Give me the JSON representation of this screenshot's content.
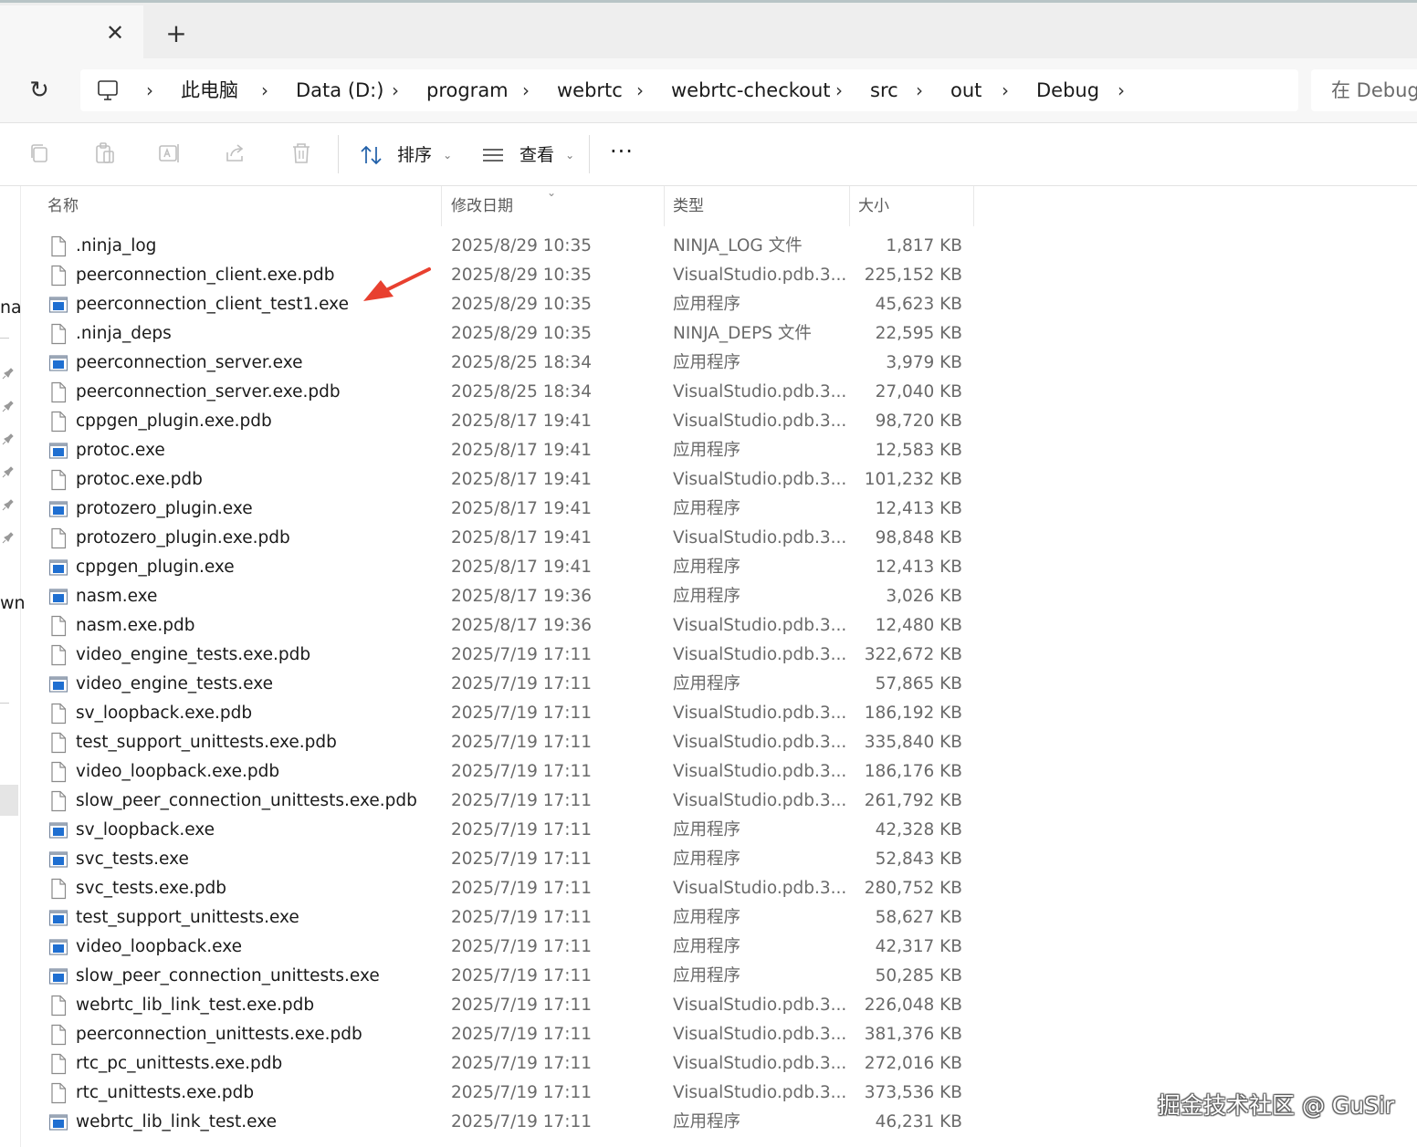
{
  "tabs": {
    "close_glyph": "✕",
    "new_glyph": "+"
  },
  "address": {
    "refresh_glyph": "↻",
    "crumbs": [
      "此电脑",
      "Data (D:)",
      "program",
      "webrtc",
      "webrtc-checkout",
      "src",
      "out",
      "Debug"
    ],
    "chevron": "›",
    "search_placeholder": "在 Debug"
  },
  "toolbar": {
    "sort_label": "排序",
    "view_label": "查看",
    "caret": "⌄",
    "more_label": "···",
    "icons": [
      "copy-icon",
      "paste-icon",
      "rename-icon",
      "share-icon",
      "delete-icon",
      "sort-icon",
      "view-icon"
    ]
  },
  "leftnav": {
    "text_1": "na",
    "text_2": "wn"
  },
  "columns": {
    "name": "名称",
    "date": "修改日期",
    "type": "类型",
    "size": "大小",
    "sort_indicator": "⌄"
  },
  "files": [
    {
      "name": ".ninja_log",
      "date": "2025/8/29 10:35",
      "type": "NINJA_LOG 文件",
      "size": "1,817 KB",
      "icon": "file"
    },
    {
      "name": "peerconnection_client.exe.pdb",
      "date": "2025/8/29 10:35",
      "type": "VisualStudio.pdb.3...",
      "size": "225,152 KB",
      "icon": "file"
    },
    {
      "name": "peerconnection_client_test1.exe",
      "date": "2025/8/29 10:35",
      "type": "应用程序",
      "size": "45,623 KB",
      "icon": "exe"
    },
    {
      "name": ".ninja_deps",
      "date": "2025/8/29 10:35",
      "type": "NINJA_DEPS 文件",
      "size": "22,595 KB",
      "icon": "file"
    },
    {
      "name": "peerconnection_server.exe",
      "date": "2025/8/25 18:34",
      "type": "应用程序",
      "size": "3,979 KB",
      "icon": "exe"
    },
    {
      "name": "peerconnection_server.exe.pdb",
      "date": "2025/8/25 18:34",
      "type": "VisualStudio.pdb.3...",
      "size": "27,040 KB",
      "icon": "file"
    },
    {
      "name": "cppgen_plugin.exe.pdb",
      "date": "2025/8/17 19:41",
      "type": "VisualStudio.pdb.3...",
      "size": "98,720 KB",
      "icon": "file"
    },
    {
      "name": "protoc.exe",
      "date": "2025/8/17 19:41",
      "type": "应用程序",
      "size": "12,583 KB",
      "icon": "exe"
    },
    {
      "name": "protoc.exe.pdb",
      "date": "2025/8/17 19:41",
      "type": "VisualStudio.pdb.3...",
      "size": "101,232 KB",
      "icon": "file"
    },
    {
      "name": "protozero_plugin.exe",
      "date": "2025/8/17 19:41",
      "type": "应用程序",
      "size": "12,413 KB",
      "icon": "exe"
    },
    {
      "name": "protozero_plugin.exe.pdb",
      "date": "2025/8/17 19:41",
      "type": "VisualStudio.pdb.3...",
      "size": "98,848 KB",
      "icon": "file"
    },
    {
      "name": "cppgen_plugin.exe",
      "date": "2025/8/17 19:41",
      "type": "应用程序",
      "size": "12,413 KB",
      "icon": "exe"
    },
    {
      "name": "nasm.exe",
      "date": "2025/8/17 19:36",
      "type": "应用程序",
      "size": "3,026 KB",
      "icon": "exe"
    },
    {
      "name": "nasm.exe.pdb",
      "date": "2025/8/17 19:36",
      "type": "VisualStudio.pdb.3...",
      "size": "12,480 KB",
      "icon": "file"
    },
    {
      "name": "video_engine_tests.exe.pdb",
      "date": "2025/7/19 17:11",
      "type": "VisualStudio.pdb.3...",
      "size": "322,672 KB",
      "icon": "file"
    },
    {
      "name": "video_engine_tests.exe",
      "date": "2025/7/19 17:11",
      "type": "应用程序",
      "size": "57,865 KB",
      "icon": "exe"
    },
    {
      "name": "sv_loopback.exe.pdb",
      "date": "2025/7/19 17:11",
      "type": "VisualStudio.pdb.3...",
      "size": "186,192 KB",
      "icon": "file"
    },
    {
      "name": "test_support_unittests.exe.pdb",
      "date": "2025/7/19 17:11",
      "type": "VisualStudio.pdb.3...",
      "size": "335,840 KB",
      "icon": "file"
    },
    {
      "name": "video_loopback.exe.pdb",
      "date": "2025/7/19 17:11",
      "type": "VisualStudio.pdb.3...",
      "size": "186,176 KB",
      "icon": "file"
    },
    {
      "name": "slow_peer_connection_unittests.exe.pdb",
      "date": "2025/7/19 17:11",
      "type": "VisualStudio.pdb.3...",
      "size": "261,792 KB",
      "icon": "file"
    },
    {
      "name": "sv_loopback.exe",
      "date": "2025/7/19 17:11",
      "type": "应用程序",
      "size": "42,328 KB",
      "icon": "exe"
    },
    {
      "name": "svc_tests.exe",
      "date": "2025/7/19 17:11",
      "type": "应用程序",
      "size": "52,843 KB",
      "icon": "exe"
    },
    {
      "name": "svc_tests.exe.pdb",
      "date": "2025/7/19 17:11",
      "type": "VisualStudio.pdb.3...",
      "size": "280,752 KB",
      "icon": "file"
    },
    {
      "name": "test_support_unittests.exe",
      "date": "2025/7/19 17:11",
      "type": "应用程序",
      "size": "58,627 KB",
      "icon": "exe"
    },
    {
      "name": "video_loopback.exe",
      "date": "2025/7/19 17:11",
      "type": "应用程序",
      "size": "42,317 KB",
      "icon": "exe"
    },
    {
      "name": "slow_peer_connection_unittests.exe",
      "date": "2025/7/19 17:11",
      "type": "应用程序",
      "size": "50,285 KB",
      "icon": "exe"
    },
    {
      "name": "webrtc_lib_link_test.exe.pdb",
      "date": "2025/7/19 17:11",
      "type": "VisualStudio.pdb.3...",
      "size": "226,048 KB",
      "icon": "file"
    },
    {
      "name": "peerconnection_unittests.exe.pdb",
      "date": "2025/7/19 17:11",
      "type": "VisualStudio.pdb.3...",
      "size": "381,376 KB",
      "icon": "file"
    },
    {
      "name": "rtc_pc_unittests.exe.pdb",
      "date": "2025/7/19 17:11",
      "type": "VisualStudio.pdb.3...",
      "size": "272,016 KB",
      "icon": "file"
    },
    {
      "name": "rtc_unittests.exe.pdb",
      "date": "2025/7/19 17:11",
      "type": "VisualStudio.pdb.3...",
      "size": "373,536 KB",
      "icon": "file"
    },
    {
      "name": "webrtc_lib_link_test.exe",
      "date": "2025/7/19 17:11",
      "type": "应用程序",
      "size": "46,231 KB",
      "icon": "exe"
    }
  ],
  "annotation": {
    "arrow_color": "#e8402f"
  },
  "watermark": "掘金技术社区 @ GuSir",
  "colors": {
    "exe_blue": "#1f6fd1",
    "icon_gray": "#8a8a8a",
    "chrome_bg": "#eeeeee"
  }
}
